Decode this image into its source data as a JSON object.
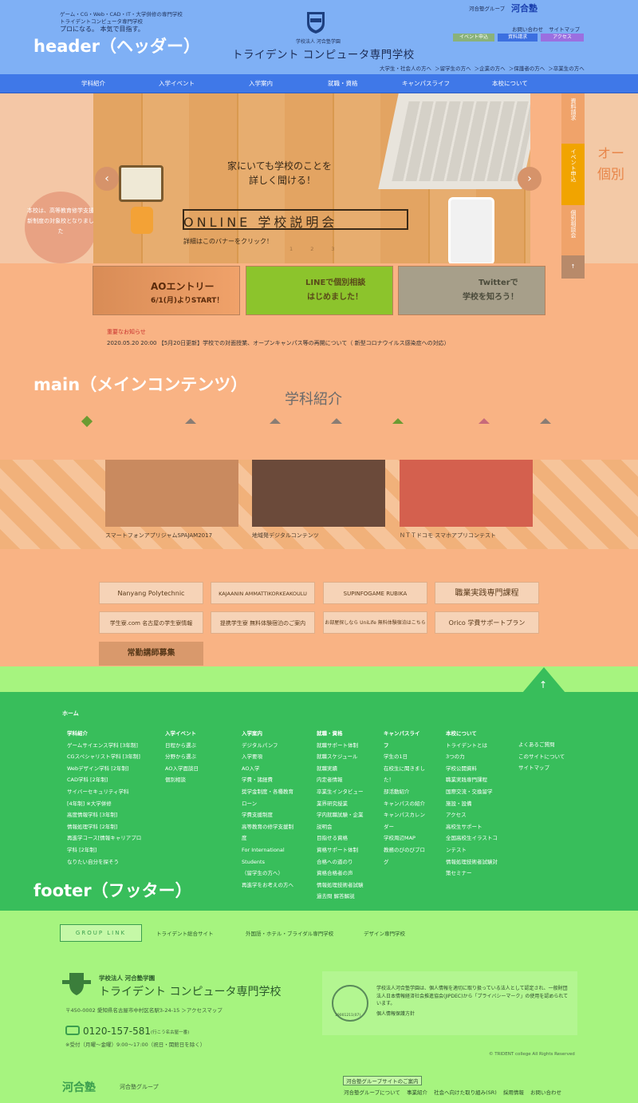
{
  "overlay_labels": {
    "header": "header（ヘッダー）",
    "main": "main（メインコンテンツ）",
    "footer": "footer（フッター）"
  },
  "header": {
    "tagline_1": "ゲーム・CG・Web・CAD・IT・大学併修の専門学校",
    "tagline_2": "トライデントコンピュータ専門学校",
    "catchphrase": "プロになる。 本気で目指す。",
    "corp_name": "学校法人 河合塾学園",
    "school_name": "トライデント コンピュータ専門学校",
    "group_label": "河合塾グループ",
    "group_logo": "河合塾",
    "util_links": [
      "お問い合わせ",
      "サイトマップ"
    ],
    "buttons": [
      {
        "label": "イベント申込",
        "color": "#8ab27a"
      },
      {
        "label": "資料請求",
        "color": "#3b6fe0"
      },
      {
        "label": "アクセス",
        "color": "#9b6fe0"
      }
    ],
    "audience_links": "大学生・社会人の方へ ＞留学生の方へ ＞企業の方へ ＞保護者の方へ ＞卒業生の方へ"
  },
  "nav": {
    "items": [
      "学科紹介",
      "入学イベント",
      "入学案内",
      "就職・資格",
      "キャンパスライフ",
      "本校について"
    ]
  },
  "hero": {
    "line1": "家にいても学校のことを",
    "line2": "詳しく聞ける！",
    "online": "ONLINE 学校説明会",
    "caption": "詳細はこのバナーをクリック！",
    "dots": "1 2 3",
    "prev": "‹",
    "next": "›",
    "side_note": "本校は、高等教育修学支援新制度の対象校となりました",
    "right_text": "オー個別"
  },
  "side_tabs": [
    "資料請求",
    "イベント申込",
    "個別相談会"
  ],
  "side_tab_colors": [
    "#f0a36a",
    "#f1a400",
    "#f0a36a"
  ],
  "side_top": "↑",
  "banners": {
    "ao_title": "AOエントリー",
    "ao_date": "6/1(月)よりSTART！",
    "line_1": "LINEで個別相談",
    "line_2": "はじめました！",
    "tw_1": "Twitterで",
    "tw_2": "学校を知ろう！"
  },
  "notice": {
    "label": "重要なお知らせ",
    "text": "2020.05.20 20:00 【5月20日更新】学校での対面授業、オープンキャンパス等の再開について（ 新型コロナウイルス感染症への対応）"
  },
  "dept": {
    "title": "学科紹介"
  },
  "dept_tab_colors": [
    "#8a7d74",
    "#8a7d74",
    "#8a7d74",
    "#6b9b32",
    "#c86a7a",
    "#8a7d74"
  ],
  "works": [
    {
      "caption": "スマートフォンアプリジャムSPAJAM2017",
      "color": "#c98a5f"
    },
    {
      "caption": "地域発デジタルコンテンツ",
      "color": "#6b4a3a"
    },
    {
      "caption": "ＮＴＴドコモ スマホアプリコンテスト",
      "color": "#d4604e"
    }
  ],
  "logo_banners": [
    "Nanyang Polytechnic",
    "KAJAANIN AMMATTIKORKEAKOULU",
    "SUPINFOGAME RUBIKA",
    "職業実践専門課程",
    "学生寮.com 名古屋の学生寮情報",
    "提携学生寮 無料体験宿泊のご案内",
    "お部屋探しなら UniLife 無料体験宿泊はこちら",
    "Orico 学費サポートプラン"
  ],
  "staff_banner": "常勤講師募集",
  "pagetop": "↑",
  "footer": {
    "home": "ホーム",
    "col1": {
      "head": "学科紹介",
      "items": [
        "ゲームサイエンス学科 [3年制]",
        "CGスペシャリスト学科 [3年制]",
        "Webデザイン学科 [2年制]",
        "CAD学科 [2年制]",
        "サイバーセキュリティ学科",
        "[4年制] ※大学併修",
        "高度情報学科 [3年制]",
        "情報処理学科 [2年制]",
        "再進学コース[情報キャリアプロ",
        "学科 [2年制]",
        "なりたい自分を探そう"
      ]
    },
    "col2": {
      "head": "入学イベント",
      "items": [
        "日程から選ぶ",
        "分野から選ぶ",
        "AO入学面談日",
        "個別相談"
      ]
    },
    "col3": {
      "head": "入学案内",
      "items": [
        "デジタルパンフ",
        "入学要項",
        "AO入学",
        "学費・諸経費",
        "奨学金制度・各種教育",
        "ローン",
        "学費支援制度",
        "高等教育の修学支援制",
        "度",
        "For International",
        "Students",
        "（留学生の方へ）",
        "再進学をお考えの方へ"
      ]
    },
    "col4": {
      "head": "就職・資格",
      "items": [
        "就職サポート体制",
        "就職スケジュール",
        "就職実績",
        "内定者情報",
        "卒業生インタビュー",
        "業界研究授業",
        "学内就職試験・企業",
        "説明会",
        "目指せる資格",
        "資格サポート体制",
        "合格への道のり",
        "資格合格者の声",
        "情報処理技術者試験",
        "過去問 解答解説"
      ]
    },
    "col5": {
      "head": "キャンパスライ",
      "head2": "フ",
      "items": [
        "学生の1日",
        "在校生に聞きまし",
        "た！",
        "部活動紹介",
        "キャンパスの紹介",
        "キャンパスカレン",
        "ダー",
        "学校周辺MAP",
        "教務のびのびブロ",
        "グ"
      ]
    },
    "col6": {
      "head": "本校について",
      "items": [
        "トライデントとは",
        "3つの力",
        "学校公開資料",
        "職業実践専門課程",
        "国際交流・交換留学",
        "施設・設備",
        "アクセス",
        "高校生サポート",
        "全国高校生イラストコ",
        "ンテスト",
        "情報処理技術者試験対",
        "策セミナー"
      ]
    },
    "col7": {
      "items": [
        "よくあるご質問",
        "このサイトについて",
        "サイトマップ"
      ]
    }
  },
  "group": {
    "label": "GROUP LINK",
    "links": [
      "トライデント総合サイト",
      "外国語・ホテル・ブライダル専門学校",
      "デザイン専門学校"
    ]
  },
  "school_info": {
    "corp": "学校法人 河合塾学園",
    "name": "トライデント コンピュータ専門学校",
    "address": "〒450-0002 愛知県名古屋市中村区名駅3-24-15 ＞アクセスマップ",
    "tel": "0120-157-581",
    "tel_note": "(行こう名古屋一番)",
    "hours": "※受付（月曜〜金曜）9:00〜17:00（祝日・関館日を除く）",
    "privacy_text": "学校法人河合塾学園は、個人情報を適切に取り扱っている法人として認定され、一般財団法人日本情報経済社会推進協会(JIPDEC)から「プライバシーマーク」の使用を認められています。",
    "privacy_link": "個人情報保護方針",
    "pmark_no": "19001211(07)",
    "copyright": "© TRIDENT college All Rights Reserved"
  },
  "kawai": {
    "logo": "河合塾",
    "group": "河合塾グループ",
    "box": "河合塾グループサイトのご案内",
    "links": [
      "河合塾グループについて",
      "事業紹介",
      "社会へ向けた取り組み(SR)",
      "採用情報",
      "お問い合わせ"
    ]
  }
}
